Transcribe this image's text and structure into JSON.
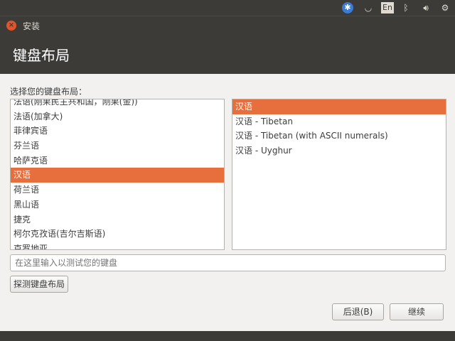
{
  "panel": {
    "keyboard_indicator": "En"
  },
  "window": {
    "title": "安装"
  },
  "header": {
    "title": "键盘布局"
  },
  "prompt": "选择您的键盘布局：",
  "layouts": [
    "法语(刚果民主共和国，刚果(金))",
    "法语(加拿大)",
    "菲律宾语",
    "芬兰语",
    "哈萨克语",
    "汉语",
    "荷兰语",
    "黑山语",
    "捷克",
    "柯尔克孜语(吉尔吉斯语)",
    "克罗地亚"
  ],
  "selected_layout": "汉语",
  "variants": [
    "汉语",
    "汉语 - Tibetan",
    "汉语 - Tibetan (with ASCII numerals)",
    "汉语 - Uyghur"
  ],
  "selected_variant": "汉语",
  "test_input": {
    "placeholder": "在这里输入以测试您的键盘",
    "value": ""
  },
  "buttons": {
    "detect": "探测键盘布局",
    "back": "后退(B)",
    "continue": "继续"
  },
  "colors": {
    "accent": "#e66f3d",
    "panel": "#3c3b37"
  }
}
